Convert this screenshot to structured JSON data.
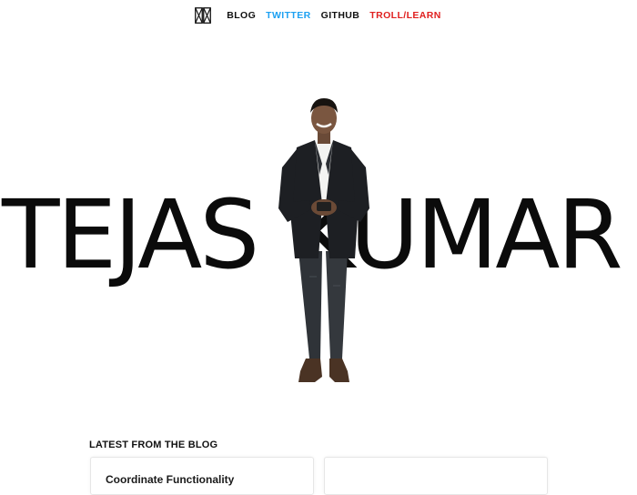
{
  "nav": {
    "items": [
      {
        "label": "BLOG",
        "color": "#111111"
      },
      {
        "label": "TWITTER",
        "color": "#1da1f2"
      },
      {
        "label": "GITHUB",
        "color": "#111111"
      },
      {
        "label": "TROLL/LEARN",
        "color": "#e0201f"
      }
    ]
  },
  "hero": {
    "first_name": "TEJAS",
    "last_name": "KUMAR"
  },
  "blog": {
    "section_title": "LATEST FROM THE BLOG",
    "cards": [
      {
        "title": "Coordinate Functionality"
      },
      {
        "title": ""
      }
    ]
  }
}
